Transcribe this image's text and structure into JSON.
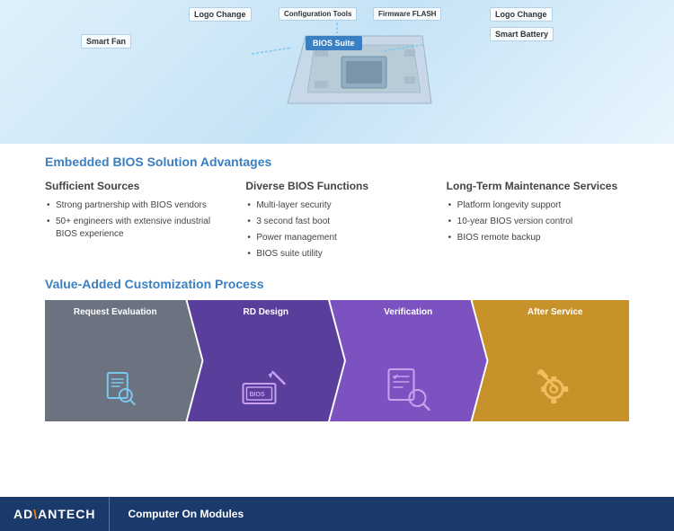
{
  "diagram": {
    "labels": {
      "smart_fan": "Smart Fan",
      "logo_change_left": "Logo Change",
      "bios_suite": "BIOS Suite",
      "smart_battery": "Smart Battery",
      "logo_change_right": "Logo Change",
      "config_tools": "Configuration Tools",
      "firmware_flash": "Firmware FLASH"
    }
  },
  "section1": {
    "title": "Embedded BIOS Solution Advantages",
    "cols": [
      {
        "header": "Sufficient Sources",
        "items": [
          "Strong partnership with BIOS vendors",
          "50+ engineers with extensive industrial BIOS experience"
        ]
      },
      {
        "header": "Diverse BIOS Functions",
        "items": [
          "Multi-layer security",
          "3 second fast boot",
          "Power management",
          "BIOS suite utility"
        ]
      },
      {
        "header": "Long-Term Maintenance Services",
        "items": [
          "Platform longevity support",
          "10-year BIOS version control",
          "BIOS remote backup"
        ]
      }
    ]
  },
  "section2": {
    "title": "Value-Added Customization Process",
    "steps": [
      {
        "label": "Request Evaluation",
        "color": "#4a5568",
        "icon": "search-doc"
      },
      {
        "label": "RD Design",
        "color": "#5a3e9b",
        "icon": "bios-chip"
      },
      {
        "label": "Verification",
        "color": "#7b52c0",
        "icon": "checklist-search"
      },
      {
        "label": "After Service",
        "color": "#c8922a",
        "icon": "wrench-gear"
      }
    ]
  },
  "footer": {
    "brand_prefix": "AD",
    "brand_highlight": "\\ANTECH",
    "brand_full": "ADVANTECH",
    "subtitle": "Computer On Modules"
  }
}
